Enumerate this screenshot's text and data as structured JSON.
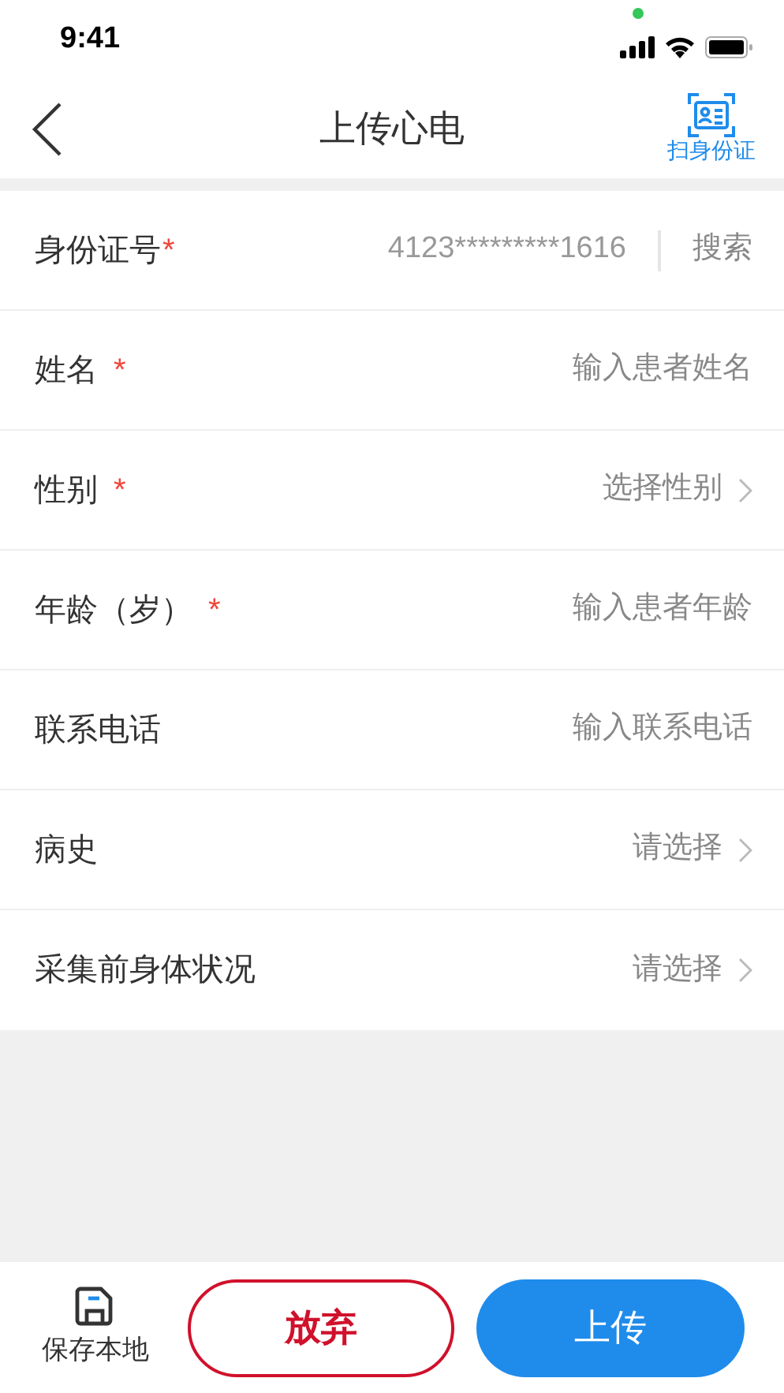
{
  "status_bar": {
    "time": "9:41"
  },
  "nav": {
    "title": "上传心电",
    "scan_label": "扫身份证"
  },
  "fields": [
    {
      "kind": "search",
      "label": "身份证号",
      "required_mark": "*",
      "value": "4123*********1616",
      "action": "搜索"
    },
    {
      "kind": "input",
      "label": "姓名",
      "required_mark": "*",
      "placeholder": "输入患者姓名"
    },
    {
      "kind": "select",
      "label": "性别",
      "required_mark": "*",
      "placeholder": "选择性别"
    },
    {
      "kind": "input",
      "label": "年龄（岁）",
      "required_mark": "*",
      "placeholder": "输入患者年龄"
    },
    {
      "kind": "input",
      "label": "联系电话",
      "placeholder": "输入联系电话"
    },
    {
      "kind": "select",
      "label": "病史",
      "placeholder": "请选择"
    },
    {
      "kind": "select",
      "label": "采集前身体状况",
      "placeholder": "请选择"
    }
  ],
  "bottom_bar": {
    "save_label": "保存本地",
    "discard": "放弃",
    "upload": "上传"
  }
}
